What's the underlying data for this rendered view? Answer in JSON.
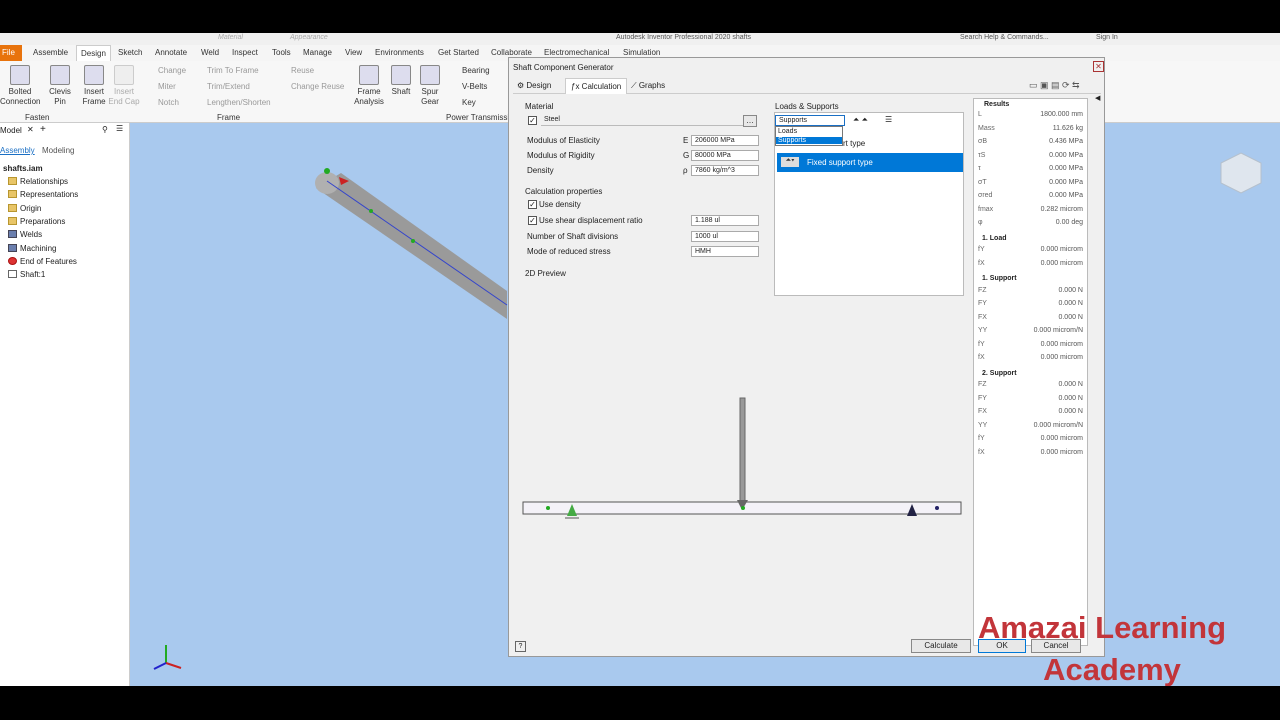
{
  "app": {
    "title": "Autodesk Inventor Professional 2020  shafts",
    "search": "Search Help & Commands...",
    "signin": "Sign In",
    "material_combo": "Material",
    "appearance_combo": "Appearance"
  },
  "ribbon_tabs": [
    "File",
    "Assemble",
    "Design",
    "Sketch",
    "Annotate",
    "Weld",
    "Inspect",
    "Tools",
    "Manage",
    "View",
    "Environments",
    "Get Started",
    "Collaborate",
    "Electromechanical",
    "Simulation"
  ],
  "ribbon": {
    "bolted": "Bolted Connection",
    "clevis": "Clevis Pin",
    "insert_frame": "Insert Frame",
    "insert_endcap": "Insert End Cap",
    "change": "Change",
    "miter": "Miter",
    "notch": "Notch",
    "trim_to_frame": "Trim To Frame",
    "trim_extend": "Trim/Extend",
    "lengthen_shorten": "Lengthen/Shorten",
    "reuse": "Reuse",
    "change_reuse": "Change Reuse",
    "frame_analysis": "Frame Analysis",
    "shaft": "Shaft",
    "spur_gear": "Spur Gear",
    "bearing": "Bearing",
    "vbelts": "V-Belts",
    "key": "Key",
    "panel_fasten": "Fasten",
    "panel_frame": "Frame",
    "panel_power": "Power Transmissi"
  },
  "browser": {
    "model_tab": "Model",
    "assembly": "Assembly",
    "modeling": "Modeling",
    "root": "shafts.iam",
    "items": [
      "Relationships",
      "Representations",
      "Origin",
      "Preparations",
      "Welds",
      "Machining",
      "End of Features",
      "Shaft:1"
    ]
  },
  "dialog": {
    "title": "Shaft Component Generator",
    "tabs": [
      "Design",
      "Calculation",
      "Graphs"
    ],
    "material": {
      "section": "Material",
      "name": "Steel",
      "elasticity_label": "Modulus of Elasticity",
      "elasticity_sym": "E",
      "elasticity": "206000 MPa",
      "rigidity_label": "Modulus of Rigidity",
      "rigidity_sym": "G",
      "rigidity": "80000 MPa",
      "density_label": "Density",
      "density_sym": "ρ",
      "density": "7860 kg/m^3"
    },
    "calc": {
      "section": "Calculation properties",
      "use_density": "Use density",
      "use_shear": "Use shear displacement ratio",
      "shear_value": "1.188 ul",
      "divisions_label": "Number of Shaft divisions",
      "divisions": "1000 ul",
      "mode_label": "Mode of reduced stress",
      "mode": "HMH"
    },
    "loads": {
      "section": "Loads & Supports",
      "combo": "Supports",
      "options": [
        "Loads",
        "Supports"
      ],
      "column": "rt type",
      "row": "Fixed support type"
    },
    "preview": "2D Preview",
    "results": {
      "title": "Results",
      "rows": [
        [
          "L",
          "1800.000 mm"
        ],
        [
          "Mass",
          "11.626 kg"
        ],
        [
          "σB",
          "0.436 MPa"
        ],
        [
          "τS",
          "0.000 MPa"
        ],
        [
          "τ",
          "0.000 MPa"
        ],
        [
          "σT",
          "0.000 MPa"
        ],
        [
          "σred",
          "0.000 MPa"
        ],
        [
          "fmax",
          "0.282 microm"
        ],
        [
          "φ",
          "0.00 deg"
        ]
      ],
      "load1": "1. Load",
      "load_rows": [
        [
          "fY",
          "0.000 microm"
        ],
        [
          "fX",
          "0.000 microm"
        ]
      ],
      "support1": "1. Support",
      "support1_rows": [
        [
          "FZ",
          "0.000 N"
        ],
        [
          "FY",
          "0.000 N"
        ],
        [
          "FX",
          "0.000 N"
        ],
        [
          "YY",
          "0.000 microm/N"
        ],
        [
          "fY",
          "0.000 microm"
        ],
        [
          "fX",
          "0.000 microm"
        ]
      ],
      "support2": "2. Support",
      "support2_rows": [
        [
          "FZ",
          "0.000 N"
        ],
        [
          "FY",
          "0.000 N"
        ],
        [
          "FX",
          "0.000 N"
        ],
        [
          "YY",
          "0.000 microm/N"
        ],
        [
          "fY",
          "0.000 microm"
        ],
        [
          "fX",
          "0.000 microm"
        ]
      ]
    },
    "buttons": {
      "calculate": "Calculate",
      "ok": "OK",
      "cancel": "Cancel"
    }
  },
  "watermark": [
    "Amazai Learning",
    "Academy"
  ],
  "colors": {
    "accent": "#0078d7",
    "watermark": "#c2353a",
    "viewport": "#a9c9ee"
  }
}
